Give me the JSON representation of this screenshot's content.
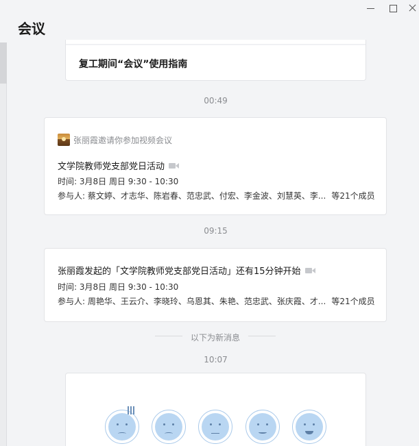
{
  "window": {
    "title": "会议"
  },
  "guide": {
    "title": "复工期间“会议”使用指南"
  },
  "timestamps": [
    "00:49",
    "09:15",
    "10:07"
  ],
  "meeting_invite": {
    "inviter_text": "张丽霞邀请你参加视频会议",
    "title": "文学院教师党支部党日活动",
    "time_label": "时间: 3月8日 周日 9:30 - 10:30",
    "participants_label": "参与人: 蔡文婷、才志华、陈岩春、范忠武、付宏、李金波、刘慧英、李...",
    "participants_count": "等21个成员"
  },
  "meeting_reminder": {
    "title": "张丽霞发起的「文学院教师党支部党日活动」还有15分钟开始",
    "time_label": "时间: 3月8日 周日 9:30 - 10:30",
    "participants_label": "参与人: 周艳华、王云介、李晓玲、乌恩其、朱艳、范忠武、张庆霞、才...",
    "participants_count": "等21个成员"
  },
  "new_messages_label": "以下为新消息",
  "survey": {
    "faces": [
      "very-unsatisfied-face-icon",
      "unsatisfied-face-icon",
      "neutral-face-icon",
      "satisfied-face-icon",
      "very-satisfied-face-icon"
    ]
  },
  "colors": {
    "background": "#f3f4f6",
    "card": "#ffffff",
    "face_fill": "#b9d6f2",
    "muted_text": "#8a8c90"
  }
}
